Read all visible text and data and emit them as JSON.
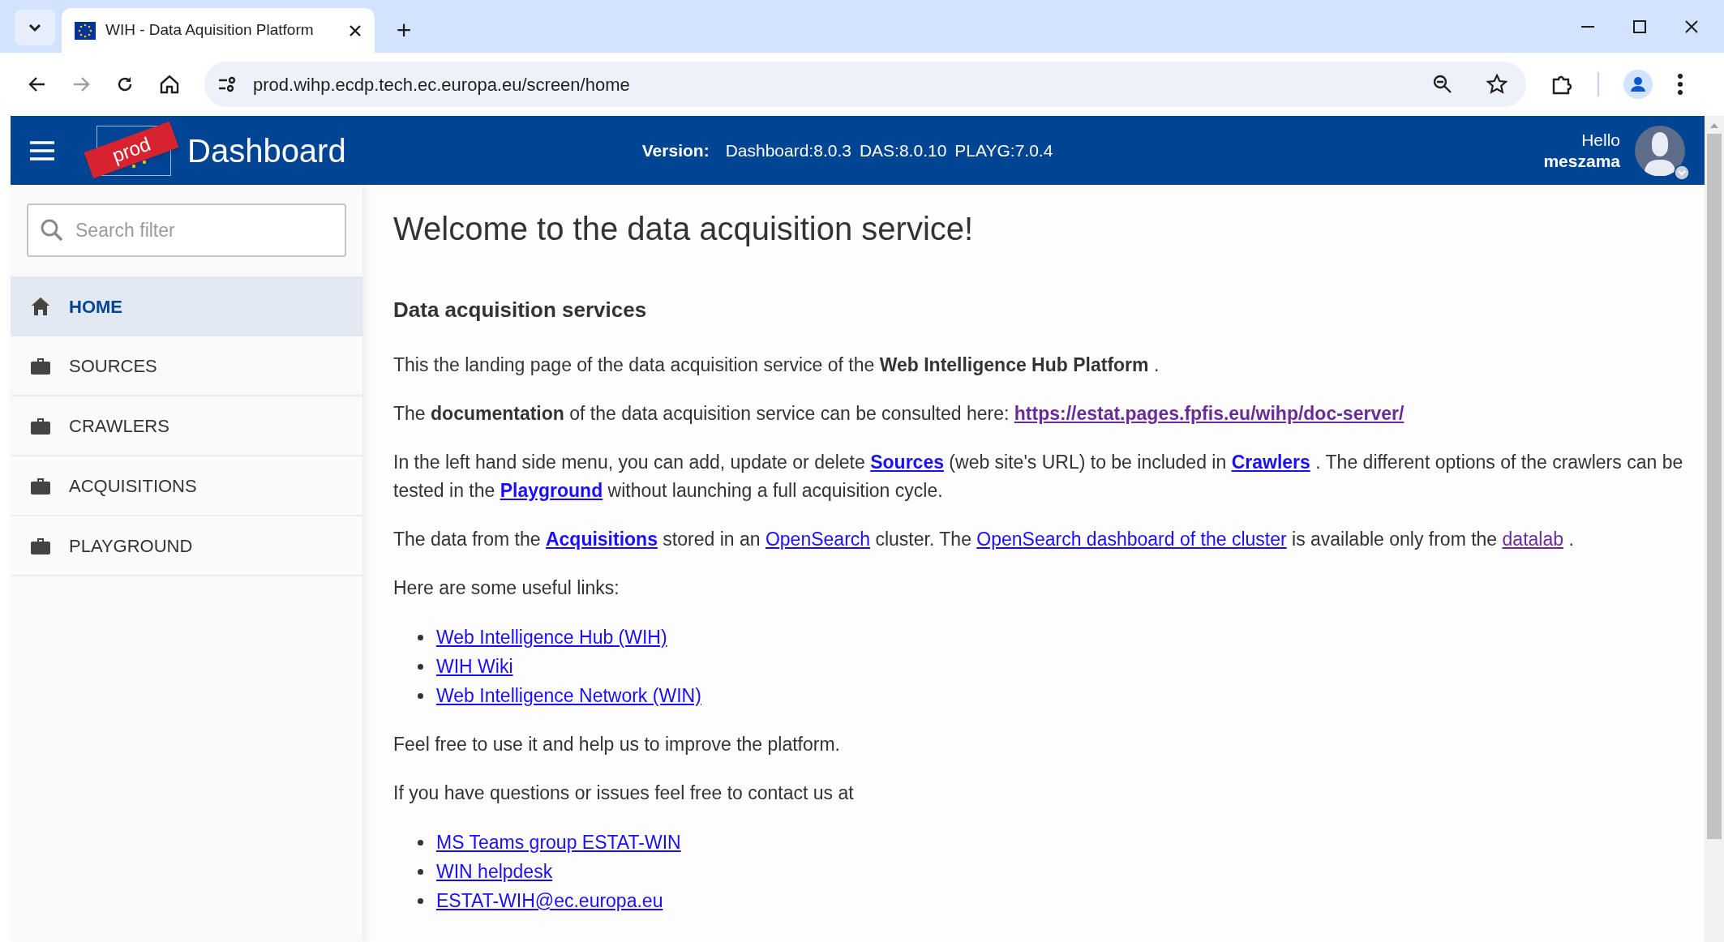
{
  "browser": {
    "tab": {
      "title": "WIH - Data Aquisition Platform",
      "selected": true
    },
    "new_tab": "+",
    "url": "prod.wihp.ecdp.tech.ec.europa.eu/screen/home",
    "forward_disabled": true
  },
  "header": {
    "env_badge": "prod",
    "title": "Dashboard",
    "version_label": "Version:",
    "versions": [
      "Dashboard:8.0.3",
      "DAS:8.0.10",
      "PLAYG:7.0.4"
    ],
    "greeting": "Hello",
    "user": "meszama"
  },
  "sidebar": {
    "search": {
      "placeholder": "Search filter"
    },
    "items": [
      {
        "label": "HOME",
        "kind": "home",
        "selected": true
      },
      {
        "label": "SOURCES",
        "kind": "section",
        "selected": false
      },
      {
        "label": "CRAWLERS",
        "kind": "section",
        "selected": false
      },
      {
        "label": "ACQUISITIONS",
        "kind": "section",
        "selected": false
      },
      {
        "label": "PLAYGROUND",
        "kind": "section",
        "selected": false
      }
    ]
  },
  "content": {
    "title": "Welcome to the data acquisition service!",
    "blocks": [
      {
        "kind": "heading",
        "text": "Data acquisition services"
      },
      {
        "kind": "paragraph",
        "segments": [
          {
            "kind": "text",
            "text": "This the landing page of the data acquisition service of the **Web Intelligence Hub Platform** ."
          }
        ]
      },
      {
        "kind": "paragraph",
        "segments": [
          {
            "kind": "text",
            "text": "The **documentation** of the data acquisition service can be consulted here:"
          },
          {
            "kind": "visited_bold_link",
            "text": "https://estat.pages.fpfis.eu/wihp/doc-server/"
          }
        ]
      },
      {
        "kind": "paragraph",
        "segments": [
          {
            "kind": "text",
            "text": "In the left hand side menu, you can add, update or delete"
          },
          {
            "kind": "bold_link",
            "text": "Sources"
          },
          {
            "kind": "text",
            "text": "(web site's URL) to be included in"
          },
          {
            "kind": "bold_link",
            "text": "Crawlers"
          },
          {
            "kind": "text",
            "text": ". The different options of the crawlers can be tested in the"
          },
          {
            "kind": "bold_link",
            "text": "Playground"
          },
          {
            "kind": "text",
            "text": "without launching a full acquisition cycle."
          }
        ]
      },
      {
        "kind": "paragraph",
        "segments": [
          {
            "kind": "text",
            "text": "The data from the"
          },
          {
            "kind": "bold_link",
            "text": "Acquisitions"
          },
          {
            "kind": "text",
            "text": "stored in an"
          },
          {
            "kind": "link",
            "text": "OpenSearch"
          },
          {
            "kind": "text",
            "text": "cluster. The"
          },
          {
            "kind": "link",
            "text": "OpenSearch dashboard of the cluster"
          },
          {
            "kind": "text",
            "text": "is available only from the"
          },
          {
            "kind": "visited_link",
            "text": "datalab"
          },
          {
            "kind": "text",
            "text": "."
          }
        ]
      },
      {
        "kind": "paragraph",
        "segments": [
          {
            "kind": "text",
            "text": "Here are some useful links:"
          }
        ]
      },
      {
        "kind": "list",
        "items": [
          "Web Intelligence Hub (WIH)",
          "WIH Wiki",
          "Web Intelligence Network (WIN)"
        ]
      },
      {
        "kind": "paragraph",
        "segments": [
          {
            "kind": "text",
            "text": "Feel free to use it and help us to improve the platform."
          }
        ]
      },
      {
        "kind": "paragraph",
        "segments": [
          {
            "kind": "text",
            "text": "If you have questions or issues feel free to contact us at"
          }
        ]
      },
      {
        "kind": "list",
        "items": [
          "MS Teams group ESTAT-WIN",
          "WIN helpdesk",
          "ESTAT-WIH@ec.europa.eu"
        ]
      }
    ]
  }
}
